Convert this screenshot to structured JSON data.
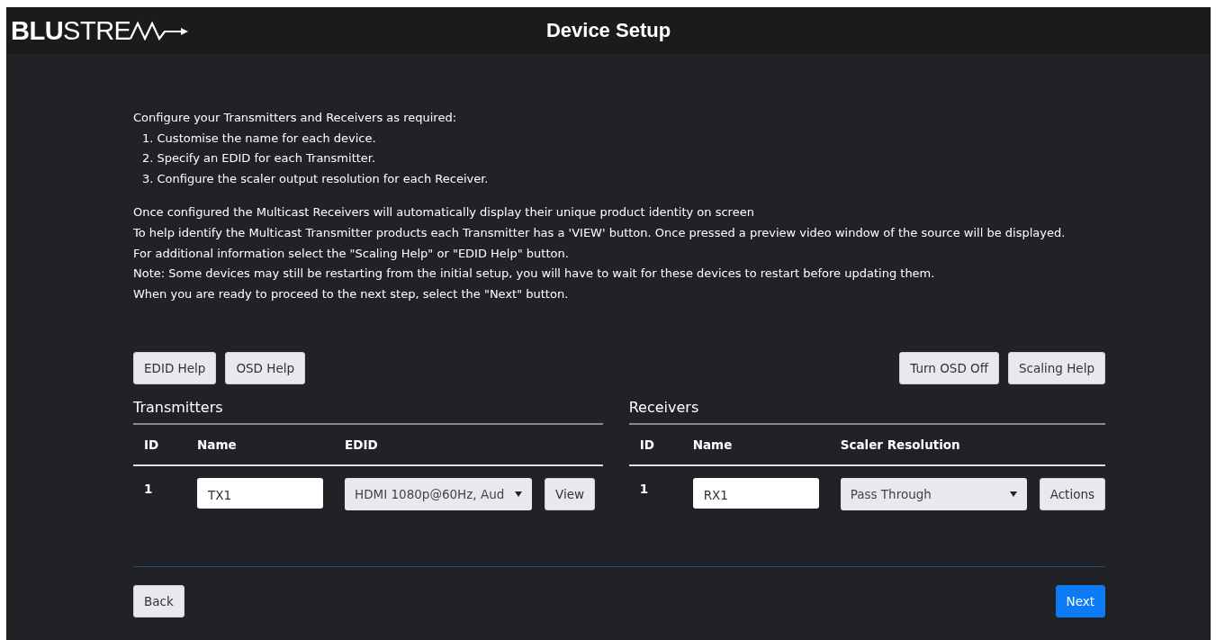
{
  "header": {
    "logo": {
      "bold": "BLU",
      "light": "STRE"
    },
    "title": "Device Setup"
  },
  "intro": {
    "lead": "Configure your Transmitters and Receivers as required:",
    "steps": [
      "1. Customise the name for each device.",
      "2. Specify an EDID for each Transmitter.",
      "3. Configure the scaler output resolution for each Receiver."
    ],
    "notes": [
      "Once configured the Multicast Receivers will automatically display their unique product identity on screen",
      "To help identify the Multicast Transmitter products each Transmitter has a 'VIEW' button. Once pressed a preview video window of the source will be displayed.",
      "For additional information select the \"Scaling Help\" or \"EDID Help\" button.",
      "Note: Some devices may still be restarting from the initial setup, you will have to wait for these devices to restart before updating them.",
      "When you are ready to proceed to the next step, select the \"Next\" button."
    ]
  },
  "left_buttons": [
    "EDID Help",
    "OSD Help"
  ],
  "right_buttons": [
    "Turn OSD Off",
    "Scaling Help"
  ],
  "transmitters": {
    "title": "Transmitters",
    "columns": [
      "ID",
      "Name",
      "EDID"
    ],
    "rows": [
      {
        "id": "1",
        "name": "TX1",
        "edid": "HDMI 1080p@60Hz, Aud",
        "action": "View"
      }
    ]
  },
  "receivers": {
    "title": "Receivers",
    "columns": [
      "ID",
      "Name",
      "Scaler Resolution"
    ],
    "rows": [
      {
        "id": "1",
        "name": "RX1",
        "resolution": "Pass Through",
        "action": "Actions"
      }
    ]
  },
  "footer": {
    "back": "Back",
    "next": "Next"
  }
}
